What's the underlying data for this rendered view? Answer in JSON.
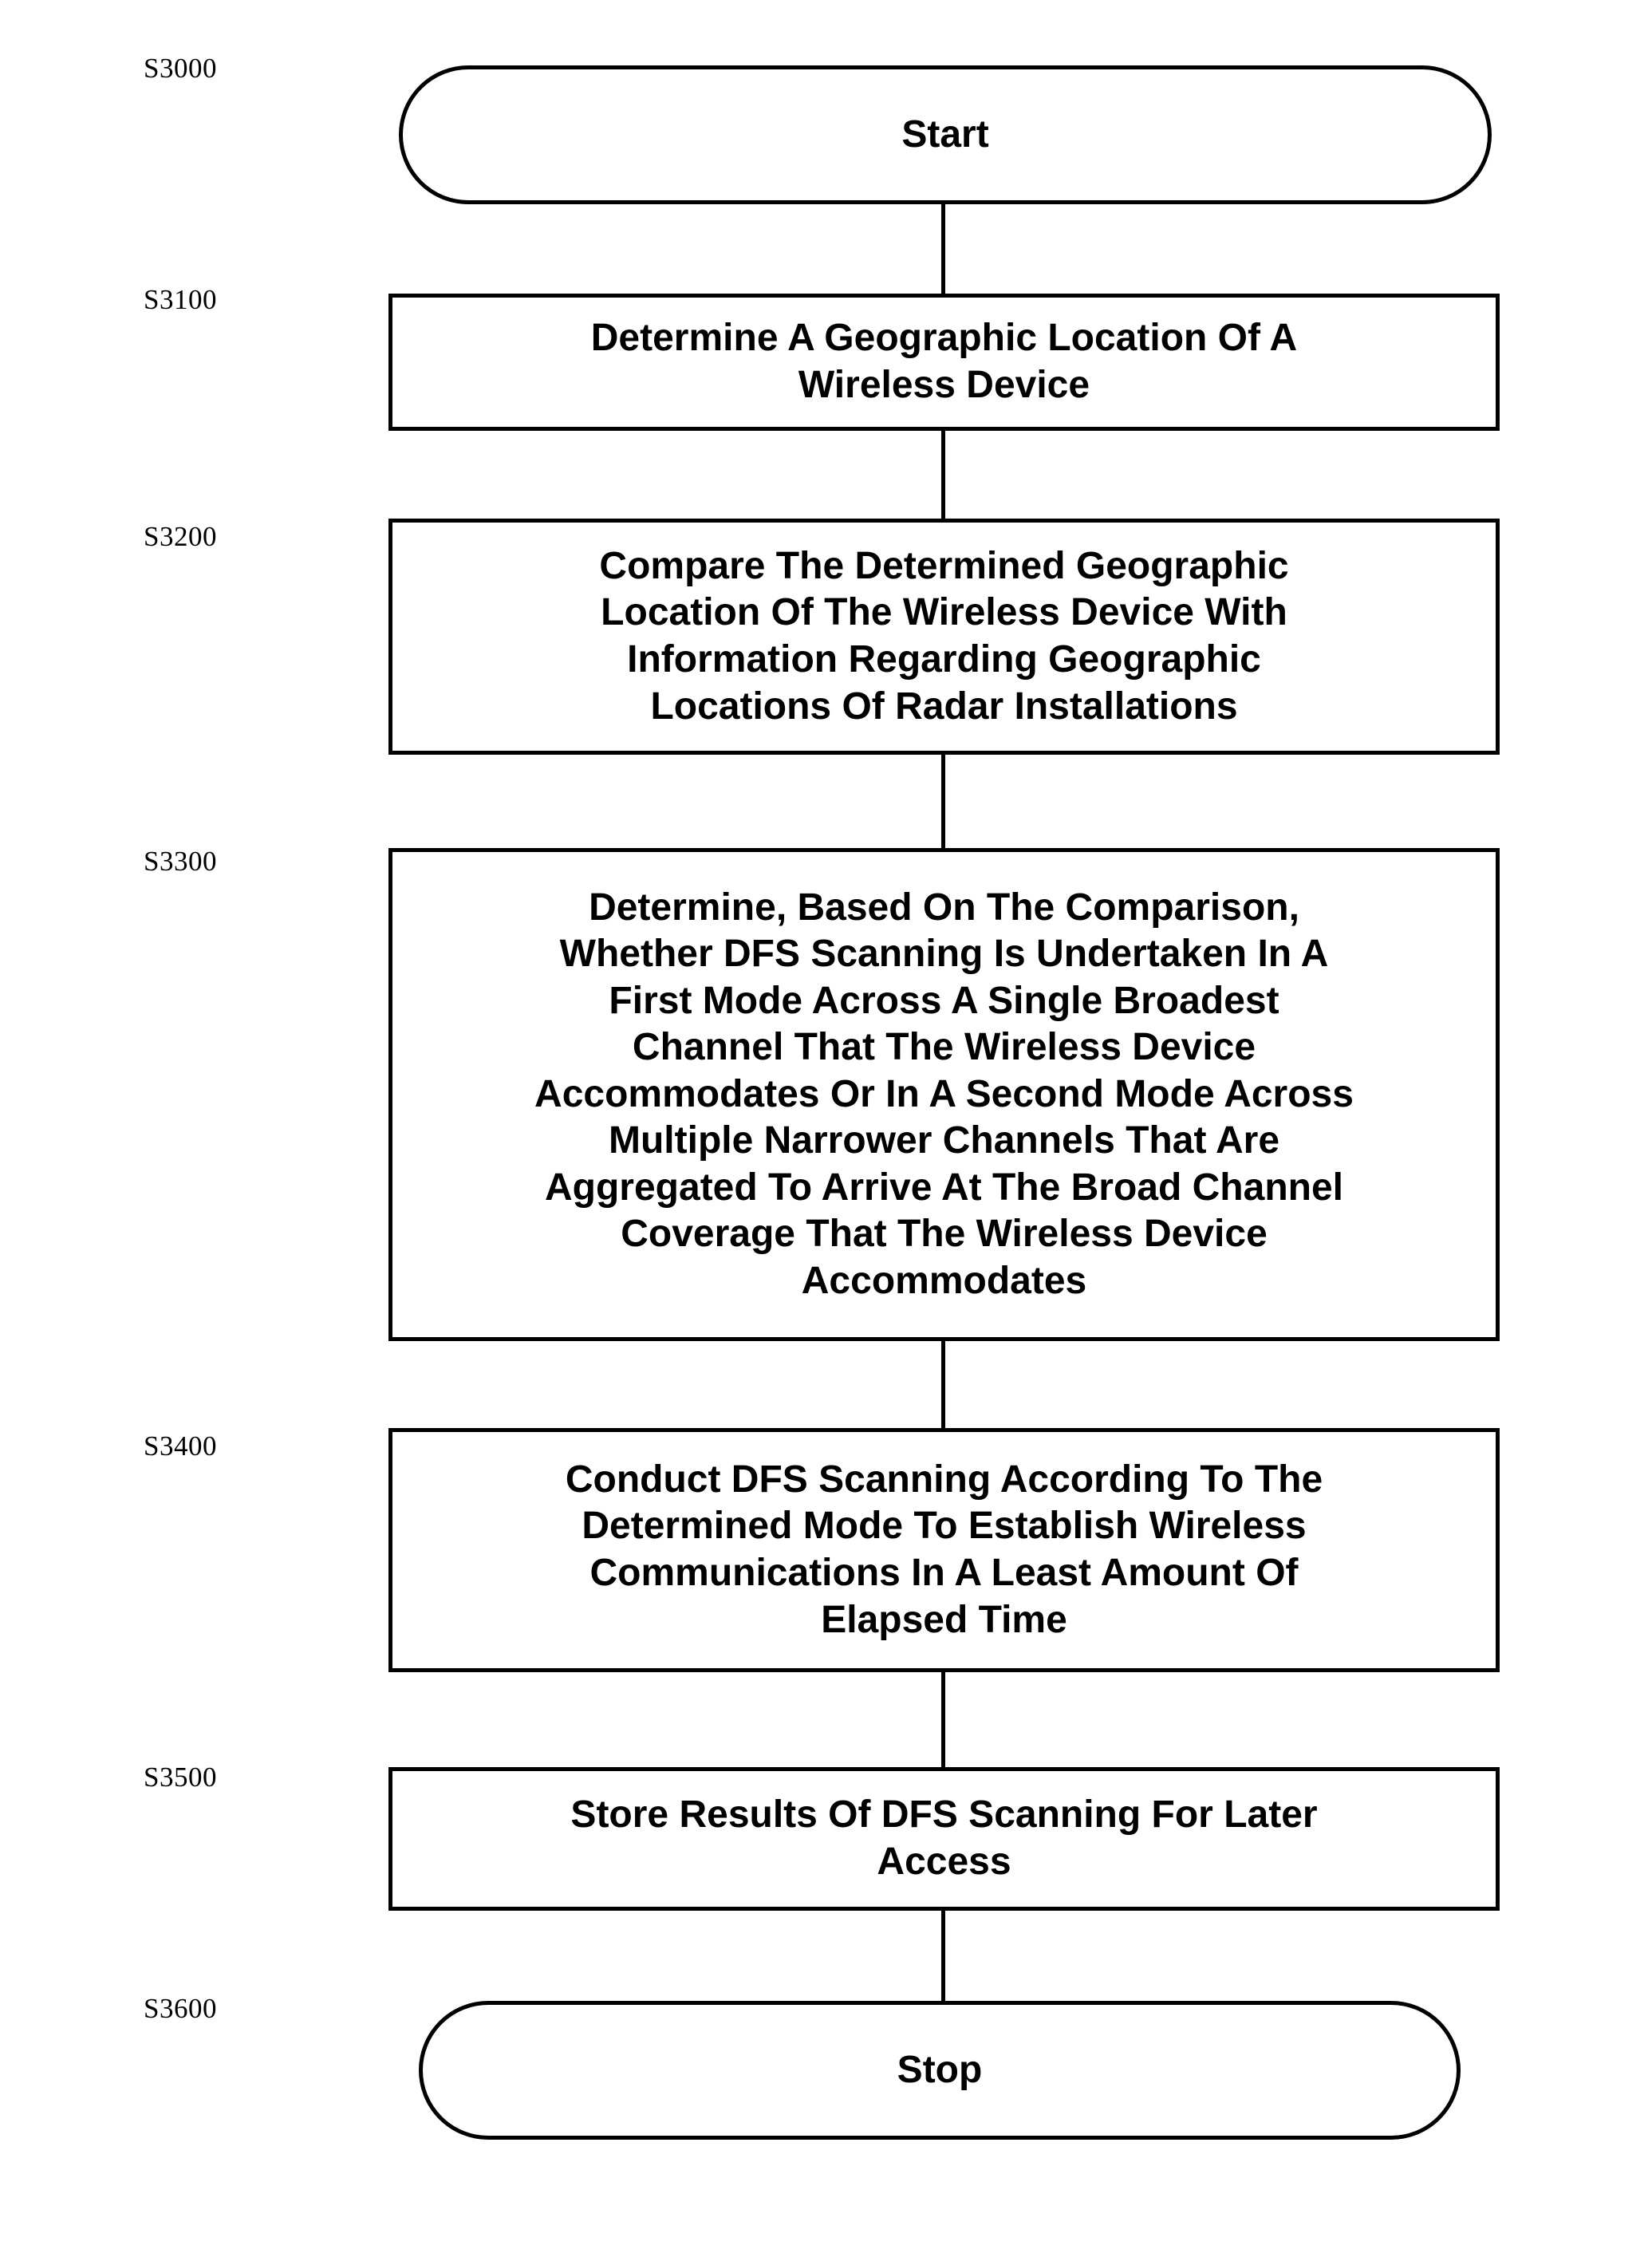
{
  "figure": {
    "type": "flowchart",
    "orientation": "vertical",
    "background_color": "#ffffff",
    "line_color": "#000000",
    "text_color": "#000000"
  },
  "nodes": [
    {
      "id": "S3000",
      "label": "S3000",
      "shape": "terminal",
      "text": "Start"
    },
    {
      "id": "S3100",
      "label": "S3100",
      "shape": "process",
      "text": "Determine A Geographic Location Of A\nWireless Device"
    },
    {
      "id": "S3200",
      "label": "S3200",
      "shape": "process",
      "text": "Compare The  Determined Geographic\nLocation Of The Wireless Device With\nInformation Regarding Geographic\nLocations Of Radar Installations"
    },
    {
      "id": "S3300",
      "label": "S3300",
      "shape": "process",
      "text": "Determine, Based On The Comparison,\nWhether DFS Scanning Is Undertaken In A\nFirst Mode Across A Single Broadest\nChannel That The Wireless Device\nAccommodates Or In A Second Mode Across\nMultiple Narrower Channels That Are\nAggregated To Arrive At The Broad Channel\nCoverage That The Wireless Device\nAccommodates"
    },
    {
      "id": "S3400",
      "label": "S3400",
      "shape": "process",
      "text": "Conduct DFS Scanning According To The\nDetermined Mode To Establish Wireless\nCommunications In A Least Amount Of\nElapsed Time"
    },
    {
      "id": "S3500",
      "label": "S3500",
      "shape": "process",
      "text": "Store Results Of DFS Scanning For Later\nAccess"
    },
    {
      "id": "S3600",
      "label": "S3600",
      "shape": "terminal",
      "text": "Stop"
    }
  ],
  "connectors": [
    {
      "from": "S3000",
      "to": "S3100"
    },
    {
      "from": "S3100",
      "to": "S3200"
    },
    {
      "from": "S3200",
      "to": "S3300"
    },
    {
      "from": "S3300",
      "to": "S3400"
    },
    {
      "from": "S3400",
      "to": "S3500"
    },
    {
      "from": "S3500",
      "to": "S3600"
    }
  ]
}
